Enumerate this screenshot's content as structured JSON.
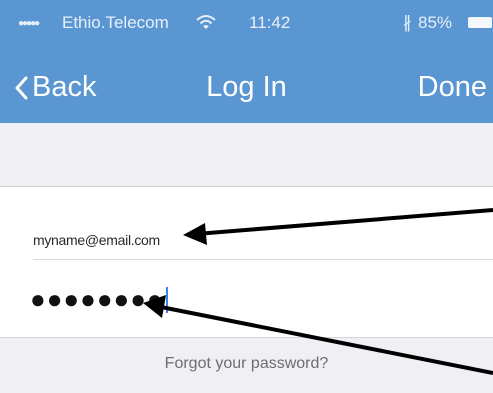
{
  "status_bar": {
    "signal_dots": "●●●●●",
    "carrier": "Ethio.Telecom",
    "time": "11:42",
    "bluetooth_glyph": "∦",
    "battery_percent": "85%",
    "wifi_icon": "wifi-icon",
    "battery_icon": "battery-icon"
  },
  "nav": {
    "back_label": "Back",
    "title": "Log In",
    "done_label": "Done"
  },
  "form": {
    "email_value": "myname@email.com",
    "password_mask": "●●●●●●●●"
  },
  "forgot_label": "Forgot your password?",
  "colors": {
    "header_blue": "#5a96d2",
    "page_background": "#efeff4",
    "arrow": "#000000"
  }
}
